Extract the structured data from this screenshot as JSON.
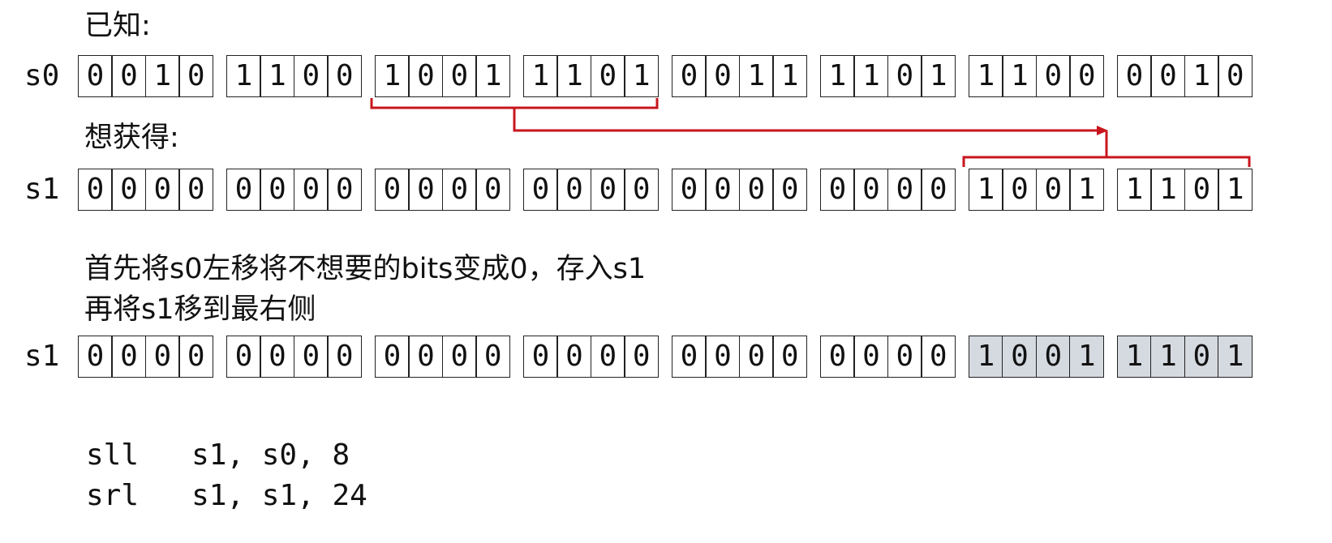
{
  "heading_known": "已知:",
  "heading_want": "想获得:",
  "explanation_line1": "首先将s0左移将不想要的bits变成0，存入s1",
  "explanation_line2": "再将s1移到最右侧",
  "registers": [
    {
      "name": "s0",
      "groups": [
        "0010",
        "1100",
        "1001",
        "1101",
        "0011",
        "1101",
        "1100",
        "0010"
      ],
      "highlight": []
    },
    {
      "name": "s1",
      "groups": [
        "0000",
        "0000",
        "0000",
        "0000",
        "0000",
        "0000",
        "1001",
        "1101"
      ],
      "highlight": []
    },
    {
      "name": "s1",
      "groups": [
        "0000",
        "0000",
        "0000",
        "0000",
        "0000",
        "0000",
        "1001",
        "1101"
      ],
      "highlight": [
        6,
        7
      ]
    }
  ],
  "code": [
    {
      "op": "sll",
      "args": "s1, s0, 8"
    },
    {
      "op": "srl",
      "args": "s1, s1, 24"
    }
  ],
  "colors": {
    "arrow": "#c8151d",
    "highlight_fill": "#d5d9e0",
    "border": "#222222"
  }
}
